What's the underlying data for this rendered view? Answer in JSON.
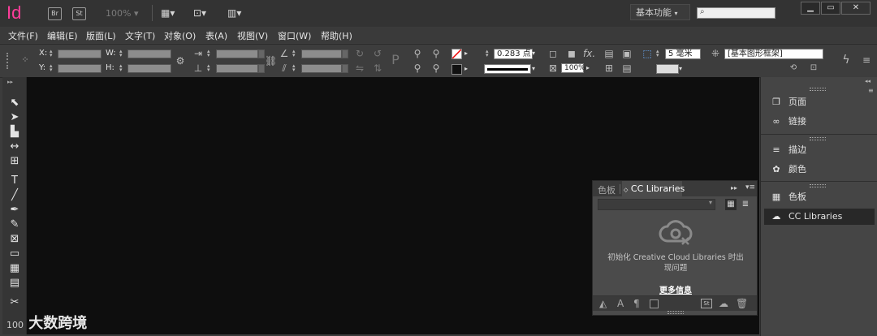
{
  "app": {
    "logo": "Id",
    "bridge": "Br",
    "stock": "St",
    "zoom": "100%",
    "workspace": "基本功能"
  },
  "window": {
    "minimize": "▁",
    "restore": "▭",
    "close": "✕"
  },
  "menu": [
    "文件(F)",
    "编辑(E)",
    "版面(L)",
    "文字(T)",
    "对象(O)",
    "表(A)",
    "视图(V)",
    "窗口(W)",
    "帮助(H)"
  ],
  "control": {
    "x_label": "X:",
    "y_label": "Y:",
    "w_label": "W:",
    "h_label": "H:",
    "stroke_weight": "0.283 点",
    "stroke_weight_field_value": "0.283 点",
    "opacity": "100%",
    "corner_size": "5 毫米",
    "object_style": "[基本图形框架]",
    "fx": "fx."
  },
  "dock": {
    "items": [
      {
        "label": "页面",
        "icon": "pages-icon"
      },
      {
        "label": "链接",
        "icon": "links-icon"
      },
      {
        "label": "描边",
        "icon": "stroke-icon"
      },
      {
        "label": "颜色",
        "icon": "color-icon"
      },
      {
        "label": "色板",
        "icon": "swatches-icon"
      },
      {
        "label": "CC Libraries",
        "icon": "cc-libraries-icon"
      }
    ]
  },
  "cc_panel": {
    "tabs": [
      "色板",
      "CC Libraries"
    ],
    "message": "初始化 Creative Cloud Libraries 时出现问题",
    "more_info": "更多信息",
    "footer_st": "St"
  },
  "watermark": {
    "text": "大数跨境",
    "prefix": "100"
  }
}
